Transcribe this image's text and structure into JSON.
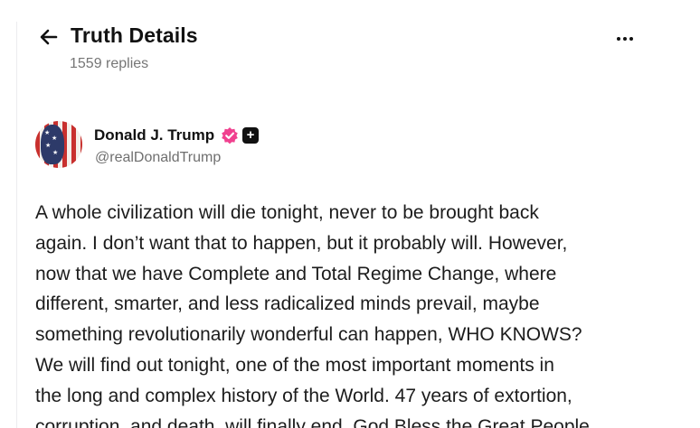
{
  "header": {
    "title": "Truth Details",
    "replies": "1559 replies"
  },
  "author": {
    "name": "Donald J. Trump",
    "handle": "@realDonaldTrump"
  },
  "post": {
    "lines": [
      "A whole civilization will die tonight, never to be brought back",
      "again. I don’t want that to happen, but it probably will. However,",
      "now that we have Complete and Total Regime Change, where",
      "different, smarter, and less radicalized minds prevail, maybe",
      "something revolutionarily wonderful can happen, WHO KNOWS?",
      "We will find out tonight, one of the most important moments in",
      "the long and complex history of the World. 47 years of extortion,",
      "corruption, and death, will finally end. God Bless the Great People"
    ]
  },
  "icons": {
    "back": "arrow-left-icon",
    "more": "more-horizontal-icon",
    "verified": "verified-badge-icon",
    "plus": "plus-badge-icon"
  },
  "colors": {
    "verified_badge": "#f0418f",
    "text_primary": "#111111",
    "text_secondary": "#767676"
  }
}
